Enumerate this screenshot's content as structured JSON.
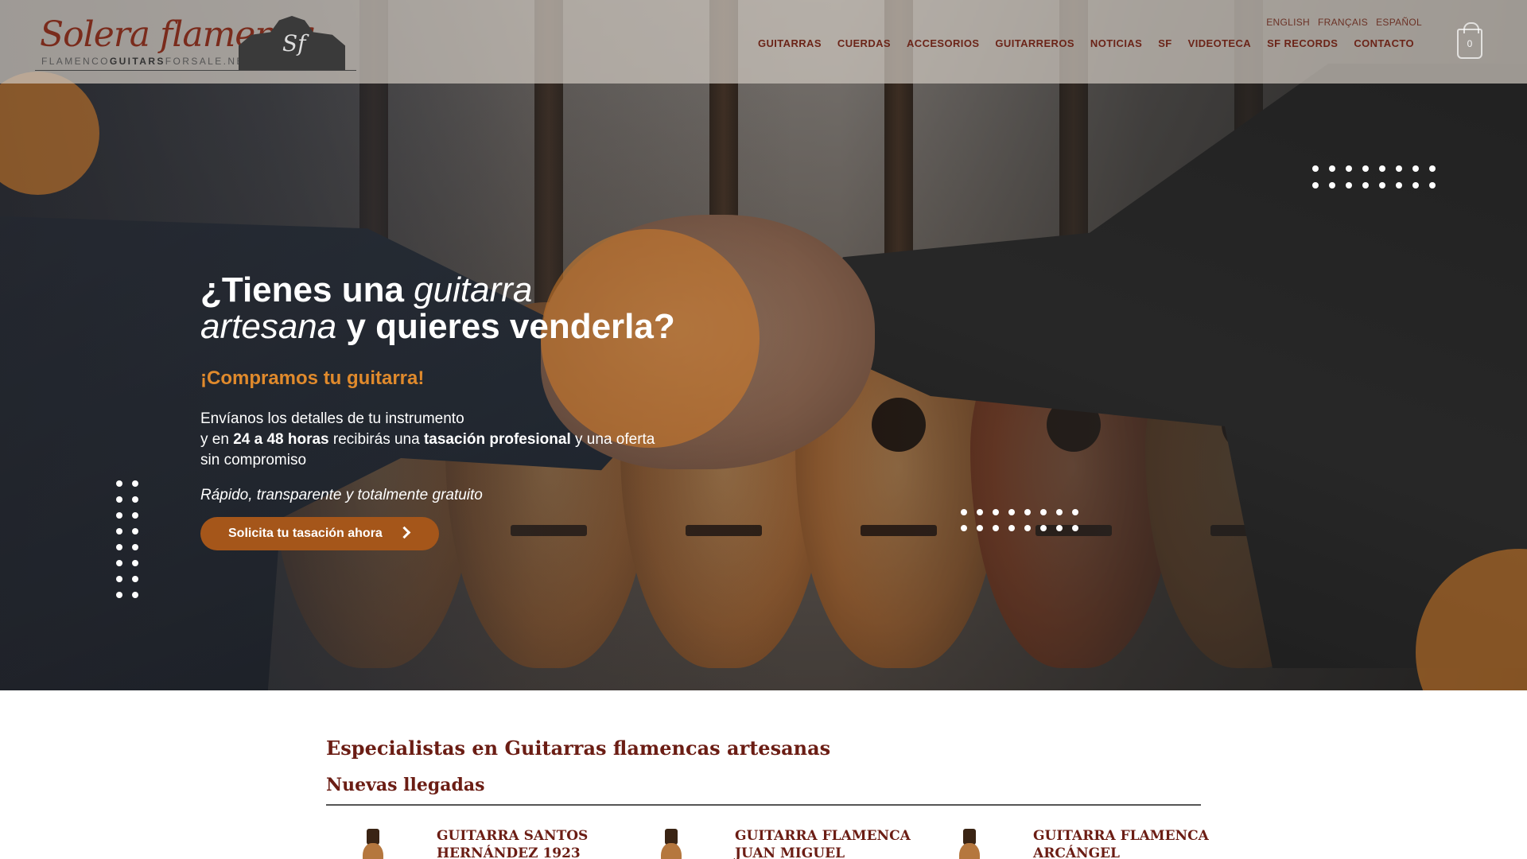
{
  "header": {
    "logo": {
      "script_text": "Solera flamenca",
      "sub_text_pre": "FLAMENCO",
      "sub_text_bold": "GUITARS",
      "sub_text_post": "FORSALE.NET",
      "badge_text": "Sf"
    },
    "languages": [
      "ENGLISH",
      "FRANÇAIS",
      "ESPAÑOL"
    ],
    "nav": [
      "GUITARRAS",
      "CUERDAS",
      "ACCESORIOS",
      "GUITARREROS",
      "NOTICIAS",
      "SF",
      "VIDEOTECA",
      "SF RECORDS",
      "CONTACTO"
    ],
    "cart_count": "0"
  },
  "hero": {
    "title_1": "¿Tienes una ",
    "title_italic_1": "guitarra",
    "title_italic_2": "artesana",
    "title_2": " y quieres venderla?",
    "subtitle": "¡Compramos tu guitarra!",
    "desc_1": "Envíanos los detalles de tu instrumento",
    "desc_2": "y en ",
    "desc_bold_1": "24 a 48 horas",
    "desc_3": " recibirás una ",
    "desc_bold_2": "tasación profesional",
    "desc_4": " y una oferta sin compromiso",
    "tagline": "Rápido, transparente y totalmente gratuito",
    "cta": "Solicita tu tasación ahora"
  },
  "content": {
    "heading": "Especialistas en Guitarras flamencas artesanas",
    "subheading": "Nuevas llegadas",
    "products": [
      {
        "title_1": "GUITARRA SANTOS",
        "title_2": "HERNÁNDEZ 1923"
      },
      {
        "title_1": "GUITARRA FLAMENCA",
        "title_2": "JUAN MIGUEL"
      },
      {
        "title_1": "GUITARRA FLAMENCA",
        "title_2": "ARCÁNGEL FERNÁNDEZ"
      }
    ]
  },
  "colors": {
    "brand": "#6b1d14",
    "accent": "#e08a2c",
    "cta": "#a5561a"
  }
}
